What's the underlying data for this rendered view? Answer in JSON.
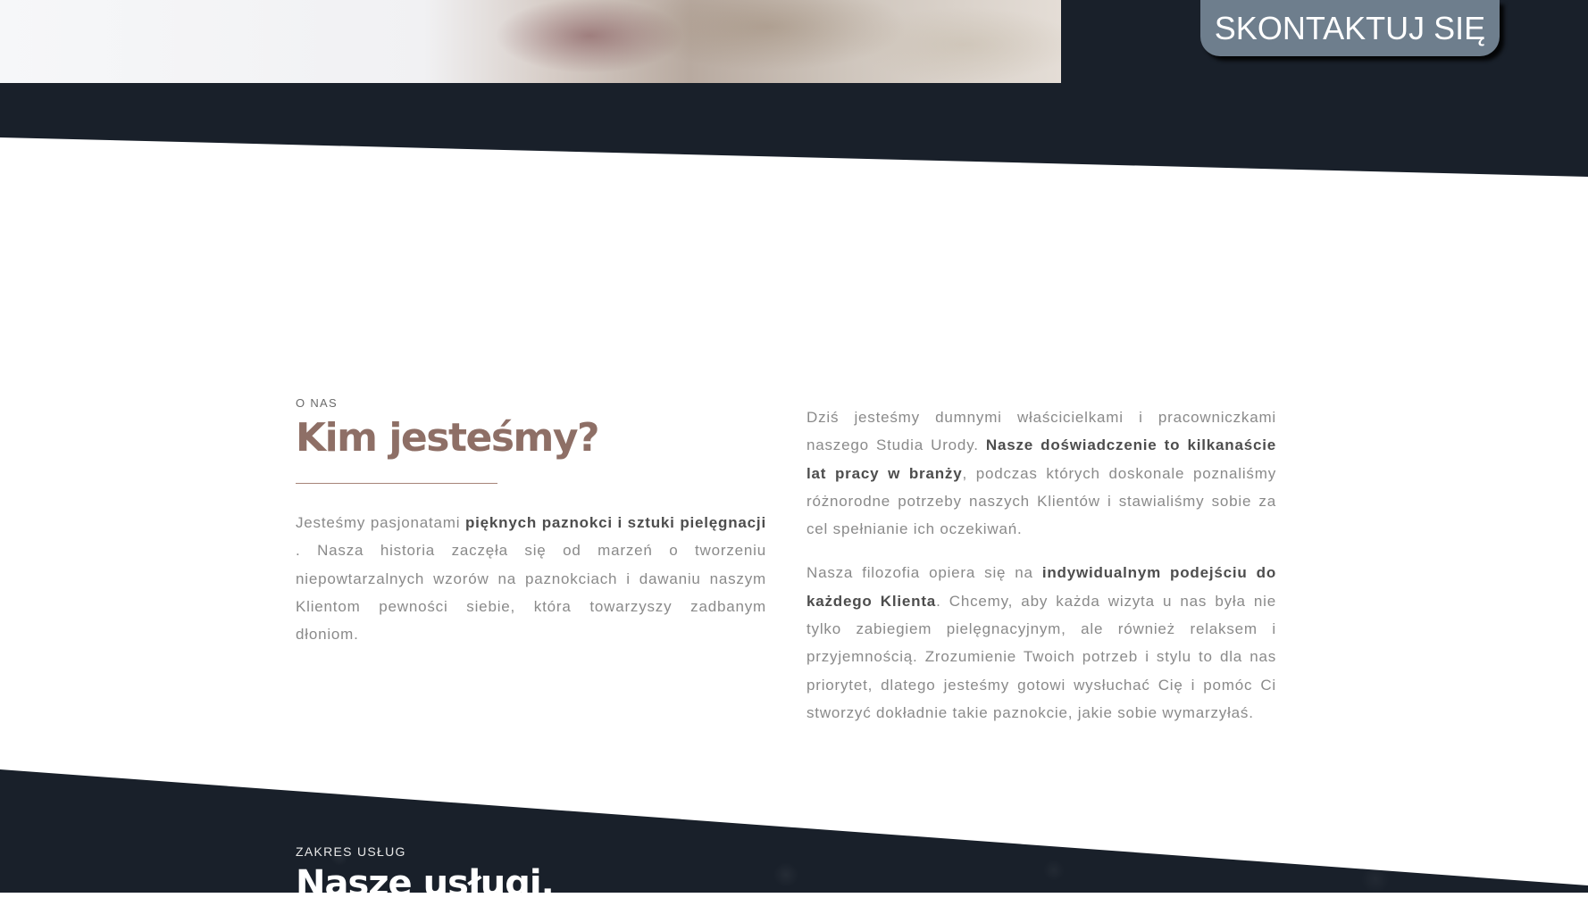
{
  "hero": {
    "contact_label": "SKONTAKTUJ SIĘ",
    "dark_color": "#19202a",
    "button_color": "#6e7e8d"
  },
  "about": {
    "eyebrow": "O NAS",
    "heading": "Kim jesteśmy?",
    "accent_color": "#8e6f66",
    "intro": {
      "text1": "Jesteśmy pasjonatami ",
      "bold1": "pięknych paznokci i sztuki pielęgnacji",
      "text2": " . Nasza historia zaczęła się od marzeń o tworzeniu niepowtarzalnych wzorów na paznokciach i dawaniu naszym Klientom pewności siebie, która towarzyszy zadbanym dłoniom."
    },
    "experience": {
      "text1": "Dziś jesteśmy dumnymi właścicielkami i pracowniczkami naszego Studia Urody. ",
      "bold1": "Nasze doświadczenie to kilkanaście lat pracy w branży",
      "text2": ", podczas których doskonale poznaliśmy różnorodne potrzeby naszych Klientów i stawialiśmy sobie za cel spełnianie ich oczekiwań."
    },
    "philosophy": {
      "text1": "Nasza filozofia opiera się na ",
      "bold1": "indywidualnym podejściu do każdego Klienta",
      "text2": ". Chcemy, aby każda wizyta u nas była nie tylko zabiegiem pielęgnacyjnym, ale również relaksem i przyjemnością. Zrozumienie Twoich potrzeb i stylu to dla nas priorytet, dlatego jesteśmy gotowi wysłuchać Cię i pomóc Ci stworzyć dokładnie takie paznokcie, jakie sobie wymarzyłaś."
    }
  },
  "services": {
    "eyebrow": "ZAKRES USŁUG",
    "heading": "Nasze usługi."
  }
}
